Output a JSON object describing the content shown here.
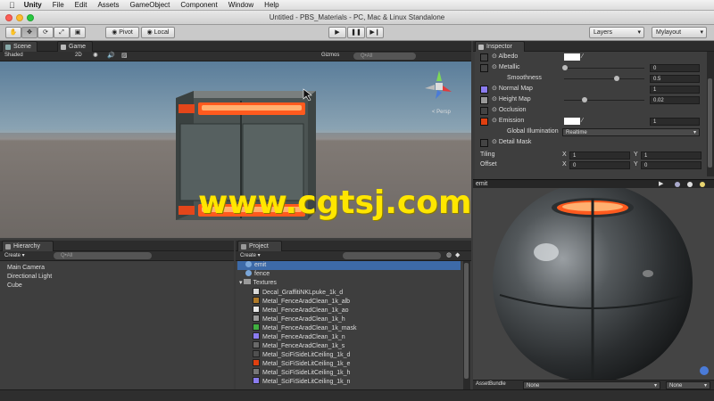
{
  "menubar": {
    "app": "Unity",
    "items": [
      "File",
      "Edit",
      "Assets",
      "GameObject",
      "Component",
      "Window",
      "Help"
    ]
  },
  "window": {
    "title": "Untitled - PBS_Materials - PC, Mac & Linux Standalone"
  },
  "toolbar": {
    "pivot": "Pivot",
    "local": "Local",
    "layers": "Layers",
    "layout": "Mylayout"
  },
  "scene": {
    "tab_scene": "Scene",
    "tab_game": "Game",
    "shading": "Shaded",
    "mode_2d": "2D",
    "gizmos": "Gizmos",
    "search_placeholder": "Q•All",
    "watermark": "www.cgtsj.com"
  },
  "hierarchy": {
    "tab": "Hierarchy",
    "create": "Create",
    "search_placeholder": "Q•All",
    "items": [
      "Main Camera",
      "Directional Light",
      "Cube"
    ]
  },
  "project": {
    "tab": "Project",
    "create": "Create",
    "materials": [
      "emit",
      "fence"
    ],
    "folder": "Textures",
    "textures": [
      {
        "name": "Decal_GraffitiNKLpuke_1k_d",
        "color": "#d8d8d8"
      },
      {
        "name": "Metal_FenceAradClean_1k_alb",
        "color": "#b07a28"
      },
      {
        "name": "Metal_FenceAradClean_1k_ao",
        "color": "#e8e8e8"
      },
      {
        "name": "Metal_FenceAradClean_1k_h",
        "color": "#9a9a9a"
      },
      {
        "name": "Metal_FenceAradClean_1k_mask",
        "color": "#40b040"
      },
      {
        "name": "Metal_FenceAradClean_1k_n",
        "color": "#8b7cf0"
      },
      {
        "name": "Metal_FenceAradClean_1k_s",
        "color": "#6a6a6a"
      },
      {
        "name": "Metal_SciFiSideLitCeiling_1k_d",
        "color": "#505050"
      },
      {
        "name": "Metal_SciFiSideLitCeiling_1k_e",
        "color": "#e04010"
      },
      {
        "name": "Metal_SciFiSideLitCeiling_1k_h",
        "color": "#777777"
      },
      {
        "name": "Metal_SciFiSideLitCeiling_1k_n",
        "color": "#8b7cf0"
      }
    ]
  },
  "inspector": {
    "tab": "Inspector",
    "albedo": "Albedo",
    "metallic": "Metallic",
    "metallic_value": "0",
    "smoothness": "Smoothness",
    "smoothness_value": "0.5",
    "normal_map": "Normal Map",
    "normal_value": "1",
    "height_map": "Height Map",
    "height_value": "0.02",
    "occlusion": "Occlusion",
    "emission": "Emission",
    "emission_value": "1",
    "global_illum": "Global Illumination",
    "global_illum_value": "Realtime",
    "detail_mask": "Detail Mask",
    "tiling": "Tiling",
    "offset": "Offset",
    "x": "X",
    "y": "Y",
    "tiling_x": "1",
    "tiling_y": "1",
    "offset_x": "0",
    "offset_y": "0"
  },
  "preview": {
    "name": "emit",
    "assetbundle": "AssetBundle",
    "bundle_value": "None",
    "variant_value": "None"
  }
}
